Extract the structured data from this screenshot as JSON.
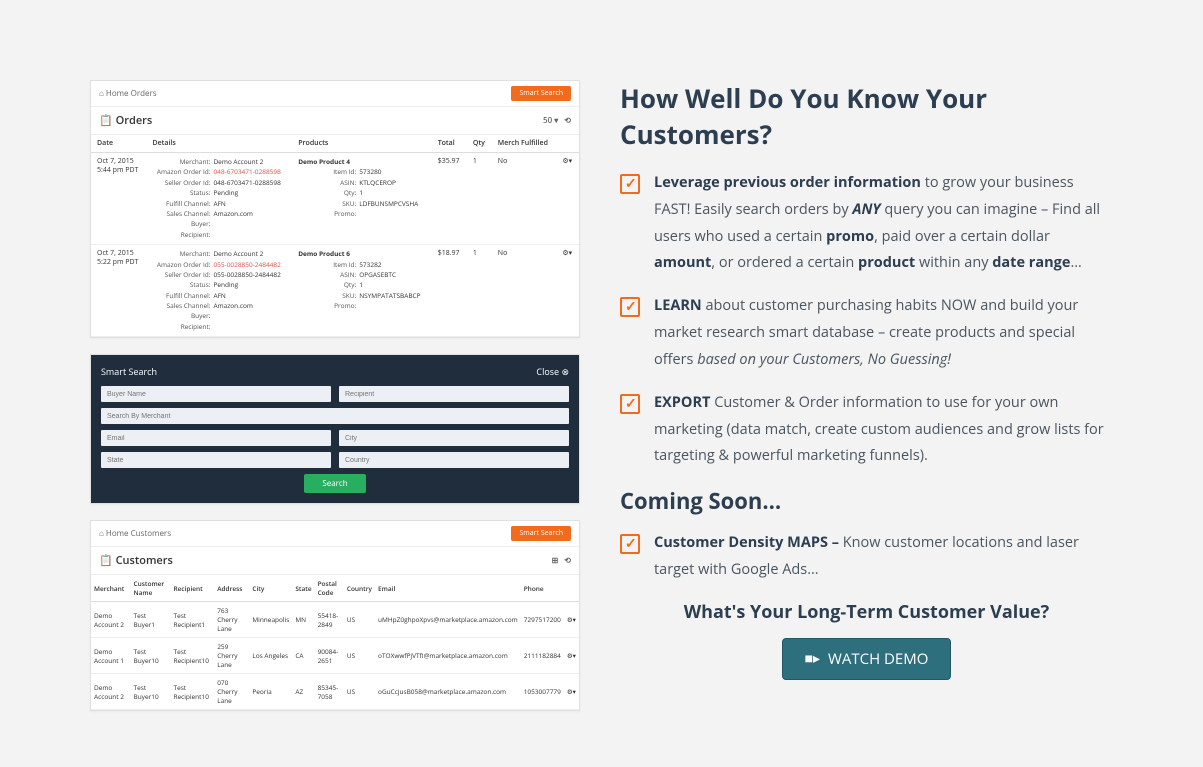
{
  "right": {
    "headline": "How Well Do You Know Your Customers?",
    "b1_pre": "Leverage previous order information",
    "b1_mid": " to grow your business FAST! Easily search orders by ",
    "b1_any": "ANY",
    "b1_post1": " query you can imagine – Find all users who used a certain ",
    "b1_promo": "promo",
    "b1_post2": ", paid over a certain dollar ",
    "b1_amount": "amount",
    "b1_post3": ", or ordered a certain ",
    "b1_product": "product",
    "b1_post4": " within any ",
    "b1_daterange": "date range",
    "b1_end": "…",
    "b2_learn": "LEARN",
    "b2_mid": " about customer purchasing habits NOW and build your market research smart database – create products and special offers ",
    "b2_ital": "based on your Customers, No Guessing!",
    "b3_export": "EXPORT",
    "b3_rest": " Customer & Order information to use for your own marketing (data match, create custom audiences and grow lists for targeting & powerful marketing funnels).",
    "coming_soon": "Coming Soon…",
    "b4_maps": "Customer Density MAPS –",
    "b4_rest": " Know customer locations and laser target with Google Ads…",
    "cta_q": "What's Your Long-Term Customer Value?",
    "cta_btn": "WATCH DEMO"
  },
  "orders_card": {
    "home": "Home",
    "crumb": "Orders",
    "smart_search": "Smart Search",
    "title": "Orders",
    "th_date": "Date",
    "th_details": "Details",
    "th_products": "Products",
    "th_total": "Total",
    "th_qty": "Qty",
    "th_fulfilled": "Merch Fulfilled",
    "rows": [
      {
        "date": "Oct 7, 2015",
        "time": "5:44 pm PDT",
        "merchant": "Demo Account 2",
        "amazon_order": "048-6703471-0288598",
        "seller_order": "048-6703471-0288598",
        "status": "Pending",
        "fulfil": "AFN",
        "channel": "Amazon.com",
        "buyer": "",
        "recipient": "",
        "product": "Demo Product 4",
        "item_id": "573280",
        "asin": "KTLQCEROP",
        "pqty": "1",
        "sku": "LDFBUNSMPCVSHA",
        "promo": "",
        "total": "$35.97",
        "qty": "1",
        "mf": "No"
      },
      {
        "date": "Oct 7, 2015",
        "time": "5:22 pm PDT",
        "merchant": "Demo Account 2",
        "amazon_order": "055-0028850-2484482",
        "seller_order": "055-0028850-2484482",
        "status": "Pending",
        "fulfil": "AFN",
        "channel": "Amazon.com",
        "buyer": "",
        "recipient": "",
        "product": "Demo Product 6",
        "item_id": "573282",
        "asin": "OPGASEBTC",
        "pqty": "1",
        "sku": "NSYMPATATSBABCP",
        "promo": "",
        "total": "$18.97",
        "qty": "1",
        "mf": "No"
      }
    ]
  },
  "search_card": {
    "title": "Smart Search",
    "close": "Close",
    "buyer_name": "Buyer Name",
    "recipient": "Recipient",
    "merchant": "Search By Merchant",
    "email": "Email",
    "city": "City",
    "state": "State",
    "country": "Country",
    "search_btn": "Search"
  },
  "customers_card": {
    "home": "Home",
    "crumb": "Customers",
    "smart_search": "Smart Search",
    "title": "Customers",
    "th_merchant": "Merchant",
    "th_customer": "Customer Name",
    "th_recipient": "Recipient",
    "th_address": "Address",
    "th_city": "City",
    "th_state": "State",
    "th_postal": "Postal Code",
    "th_country": "Country",
    "th_email": "Email",
    "th_phone": "Phone",
    "rows": [
      {
        "merchant": "Demo Account 2",
        "customer": "Test Buyer1",
        "recipient": "Test Recipient1",
        "address": "763 Cherry Lane",
        "city": "Minneapolis",
        "state": "MN",
        "postal": "55418-2849",
        "country": "US",
        "email": "uMHpZ0ghpoXpvs@marketplace.amazon.com",
        "phone": "7297517200"
      },
      {
        "merchant": "Demo Account 1",
        "customer": "Test Buyer10",
        "recipient": "Test Recipient10",
        "address": "259 Cherry Lane",
        "city": "Los Angeles",
        "state": "CA",
        "postal": "90084-2651",
        "country": "US",
        "email": "oTOXwwfPjVTfI@marketplace.amazon.com",
        "phone": "2111182884"
      },
      {
        "merchant": "Demo Account 2",
        "customer": "Test Buyer10",
        "recipient": "Test Recipient10",
        "address": "070 Cherry Lane",
        "city": "Peoria",
        "state": "AZ",
        "postal": "85345-7058",
        "country": "US",
        "email": "oGuCcjusB058@marketplace.amazon.com",
        "phone": "1053007779"
      }
    ]
  }
}
